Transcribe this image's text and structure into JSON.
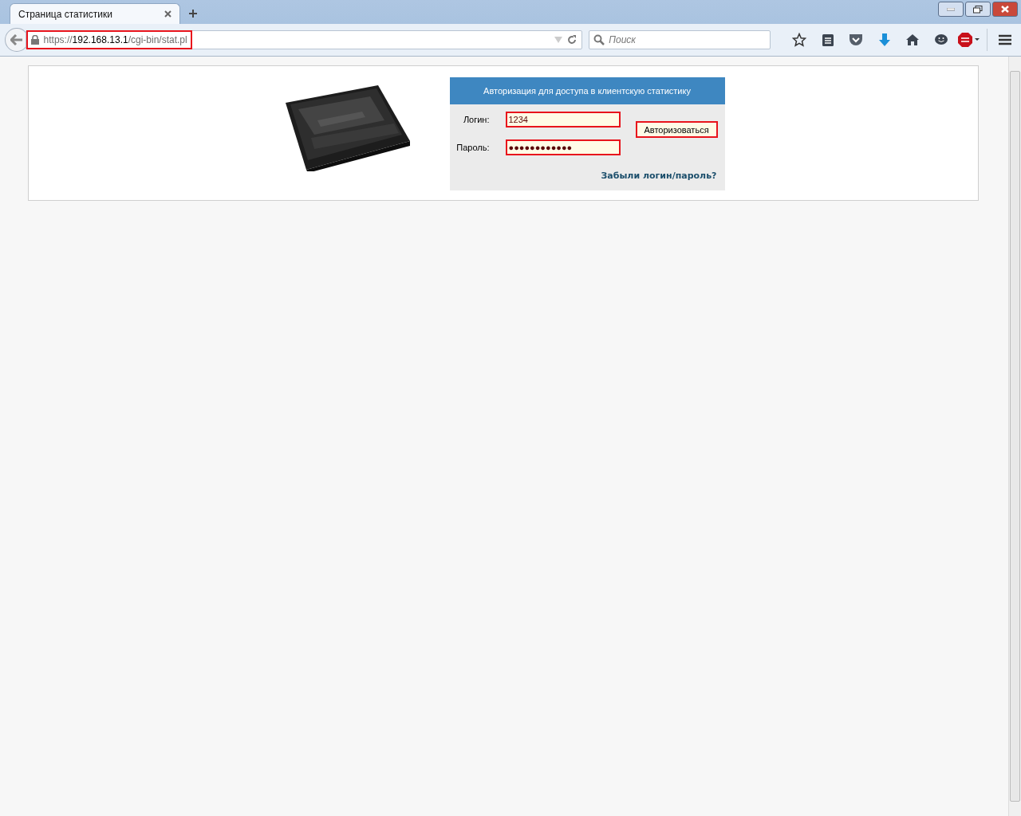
{
  "browser": {
    "tab": {
      "title": "Страница статистики",
      "selected": true
    },
    "address": {
      "scheme": "https://",
      "host": "192.168.13.1",
      "path": "/cgi-bin/stat.pl",
      "highlighted": true
    },
    "search": {
      "placeholder": "Поиск"
    }
  },
  "login_panel": {
    "header": "Авторизация для доступа в клиентскую статистику",
    "fields": [
      {
        "label": "Логин:",
        "value": "1234",
        "highlighted": true
      },
      {
        "label": "Пароль:",
        "value": "●●●●●●●●●●●●",
        "highlighted": true
      }
    ],
    "submit": {
      "label": "Авторизоваться",
      "highlighted": true
    },
    "forgot_link": "Забыли логин/пароль?"
  }
}
